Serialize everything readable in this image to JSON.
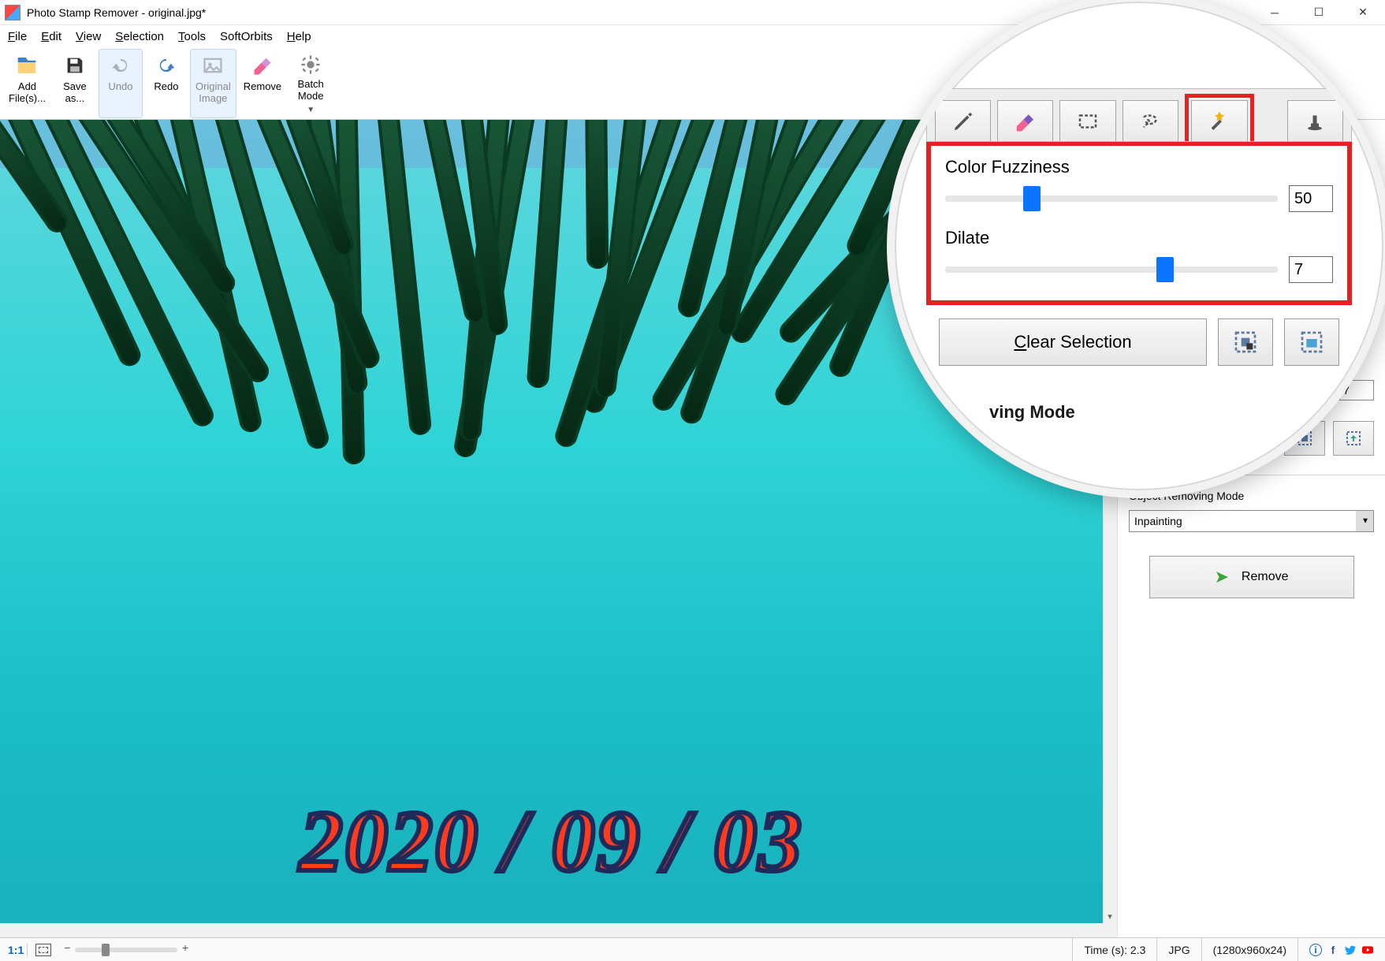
{
  "titlebar": {
    "title": "Photo Stamp Remover - original.jpg*"
  },
  "menu": {
    "file": "File",
    "edit": "Edit",
    "view": "View",
    "selection": "Selection",
    "tools": "Tools",
    "softorbits": "SoftOrbits",
    "help": "Help"
  },
  "toolbar": {
    "add_files_l1": "Add",
    "add_files_l2": "File(s)...",
    "save_as_l1": "Save",
    "save_as_l2": "as...",
    "undo": "Undo",
    "redo": "Redo",
    "original_l1": "Original",
    "original_l2": "Image",
    "remove": "Remove",
    "batch_l1": "Batch",
    "batch_l2": "Mode"
  },
  "image": {
    "date_stamp": "2020 / 09 / 03"
  },
  "side_panel": {
    "color_fuzziness_label": "Color Fuzziness",
    "color_fuzziness_value": "50",
    "dilate_label": "Dilate",
    "dilate_value": "7",
    "clear_selection": "Clear Selection",
    "mode_label": "Object Removing Mode",
    "mode_value": "Inpainting",
    "remove_button": "Remove"
  },
  "callout": {
    "color_fuzziness_label": "Color Fuzziness",
    "color_fuzziness_value": "50",
    "dilate_label": "Dilate",
    "dilate_value": "7",
    "clear_selection": "Clear Selection",
    "mode_suffix": "ving Mode"
  },
  "close_tab": {
    "x": "×"
  },
  "statusbar": {
    "zoom_11": "1:1",
    "time": "Time (s): 2.3",
    "format": "JPG",
    "dims": "(1280x960x24)"
  }
}
